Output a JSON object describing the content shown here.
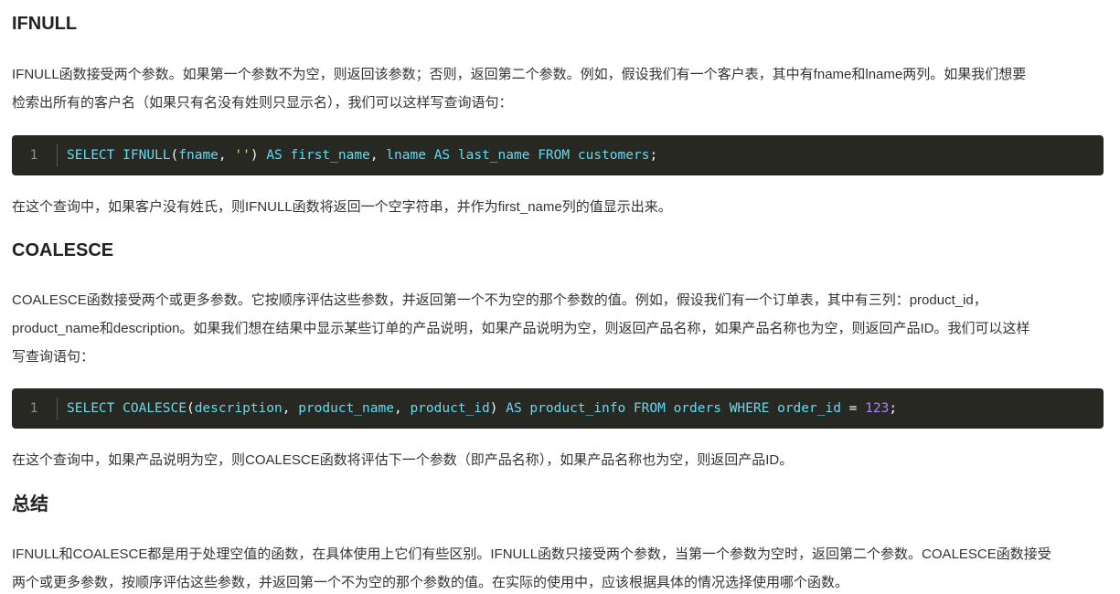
{
  "sections": [
    {
      "heading": "IFNULL",
      "paragraph_line1": "IFNULL函数接受两个参数。如果第一个参数不为空，则返回该参数；否则，返回第二个参数。例如，假设我们有一个客户表，其中有fname和lname两列。如果我们想要",
      "paragraph_line2": "检索出所有的客户名（如果只有名没有姓则只显示名），我们可以这样写查询语句：",
      "code": {
        "line_number": "1",
        "tokens": [
          {
            "t": "SELECT",
            "c": "kw"
          },
          {
            "t": " ",
            "c": "pn"
          },
          {
            "t": "IFNULL",
            "c": "fn"
          },
          {
            "t": "(",
            "c": "pn"
          },
          {
            "t": "fname",
            "c": "id"
          },
          {
            "t": ", ",
            "c": "pn"
          },
          {
            "t": "''",
            "c": "str"
          },
          {
            "t": ") ",
            "c": "pn"
          },
          {
            "t": "AS",
            "c": "kw"
          },
          {
            "t": " ",
            "c": "pn"
          },
          {
            "t": "first_name",
            "c": "id"
          },
          {
            "t": ", ",
            "c": "pn"
          },
          {
            "t": "lname",
            "c": "id"
          },
          {
            "t": " ",
            "c": "pn"
          },
          {
            "t": "AS",
            "c": "kw"
          },
          {
            "t": " ",
            "c": "pn"
          },
          {
            "t": "last_name",
            "c": "id"
          },
          {
            "t": " ",
            "c": "pn"
          },
          {
            "t": "FROM",
            "c": "kw"
          },
          {
            "t": " ",
            "c": "pn"
          },
          {
            "t": "customers",
            "c": "id"
          },
          {
            "t": ";",
            "c": "pn"
          }
        ]
      },
      "after_code": "在这个查询中，如果客户没有姓氏，则IFNULL函数将返回一个空字符串，并作为first_name列的值显示出来。"
    },
    {
      "heading": "COALESCE",
      "paragraph_line1": "COALESCE函数接受两个或更多参数。它按顺序评估这些参数，并返回第一个不为空的那个参数的值。例如，假设我们有一个订单表，其中有三列：product_id，",
      "paragraph_line2": "product_name和description。如果我们想在结果中显示某些订单的产品说明，如果产品说明为空，则返回产品名称，如果产品名称也为空，则返回产品ID。我们可以这样",
      "paragraph_line3": "写查询语句：",
      "code": {
        "line_number": "1",
        "tokens": [
          {
            "t": "SELECT",
            "c": "kw"
          },
          {
            "t": " ",
            "c": "pn"
          },
          {
            "t": "COALESCE",
            "c": "fn"
          },
          {
            "t": "(",
            "c": "pn"
          },
          {
            "t": "description",
            "c": "id"
          },
          {
            "t": ", ",
            "c": "pn"
          },
          {
            "t": "product_name",
            "c": "id"
          },
          {
            "t": ", ",
            "c": "pn"
          },
          {
            "t": "product_id",
            "c": "id"
          },
          {
            "t": ") ",
            "c": "pn"
          },
          {
            "t": "AS",
            "c": "kw"
          },
          {
            "t": " ",
            "c": "pn"
          },
          {
            "t": "product_info",
            "c": "id"
          },
          {
            "t": " ",
            "c": "pn"
          },
          {
            "t": "FROM",
            "c": "kw"
          },
          {
            "t": " ",
            "c": "pn"
          },
          {
            "t": "orders",
            "c": "id"
          },
          {
            "t": " ",
            "c": "pn"
          },
          {
            "t": "WHERE",
            "c": "kw"
          },
          {
            "t": " ",
            "c": "pn"
          },
          {
            "t": "order_id",
            "c": "id"
          },
          {
            "t": " ",
            "c": "pn"
          },
          {
            "t": "=",
            "c": "op"
          },
          {
            "t": " ",
            "c": "pn"
          },
          {
            "t": "123",
            "c": "num"
          },
          {
            "t": ";",
            "c": "pn"
          }
        ]
      },
      "after_code": "在这个查询中，如果产品说明为空，则COALESCE函数将评估下一个参数（即产品名称），如果产品名称也为空，则返回产品ID。"
    }
  ],
  "summary": {
    "heading": "总结",
    "paragraph_line1": "IFNULL和COALESCE都是用于处理空值的函数，在具体使用上它们有些区别。IFNULL函数只接受两个参数，当第一个参数为空时，返回第二个参数。COALESCE函数接受",
    "paragraph_line2": "两个或更多参数，按顺序评估这些参数，并返回第一个不为空的那个参数的值。在实际的使用中，应该根据具体的情况选择使用哪个函数。"
  },
  "colors": {
    "code_background": "#272822",
    "keyword": "#66d9ef",
    "string": "#e6db74",
    "number": "#ae81ff",
    "text": "#333333"
  }
}
